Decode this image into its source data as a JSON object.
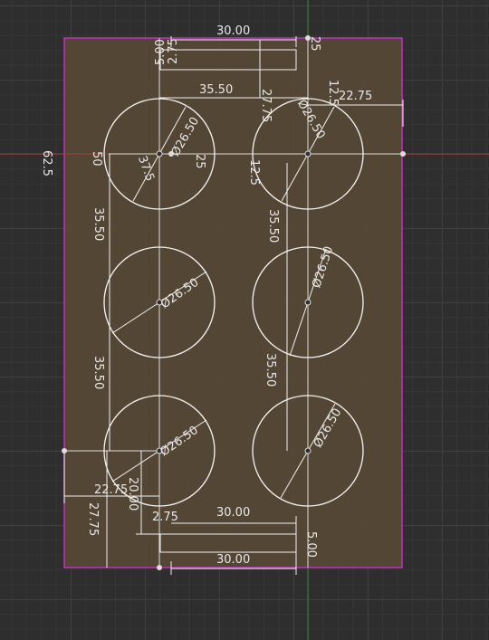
{
  "colors": {
    "background": "#2e2e2e",
    "sheet_fill": "#5a4a36",
    "sheet_border": "#c832c8",
    "axis_red": "#a83a3a",
    "axis_green": "#3a8a3a",
    "sketch": "#f2f2f2"
  },
  "dimensions": {
    "top_width": "30.00",
    "slot_height": "5.00",
    "slot_offset": "2.75",
    "top_right_small": "25",
    "top_spacing": "35.50",
    "slot_to_hole": "27.75",
    "right_small": "12.5",
    "right_offset": "22.75",
    "hole_dia_1": "Ø26.50",
    "hole_dia_2": "Ø26.50",
    "hole_dia_3": "Ø26.50",
    "hole_dia_4": "Ø26.50",
    "hole_dia_5": "Ø26.50",
    "hole_dia_6": "Ø26.50",
    "left_half": "62.5",
    "left_fifty": "50",
    "radius_label": "37.5",
    "center_25": "25",
    "center_12_5": "12.5",
    "vert_spacing_1": "35.50",
    "vert_spacing_2": "35.50",
    "vert_spacing_3": "35.50",
    "vert_spacing_4": "35.50",
    "bottom_left_offset": "22.75",
    "bottom_20": "20.00",
    "bottom_slot_offset": "2.75",
    "bottom_left_27": "27.75",
    "bottom_width_1": "30.00",
    "bottom_slot_height": "5.00",
    "bottom_width_2": "30.00"
  }
}
